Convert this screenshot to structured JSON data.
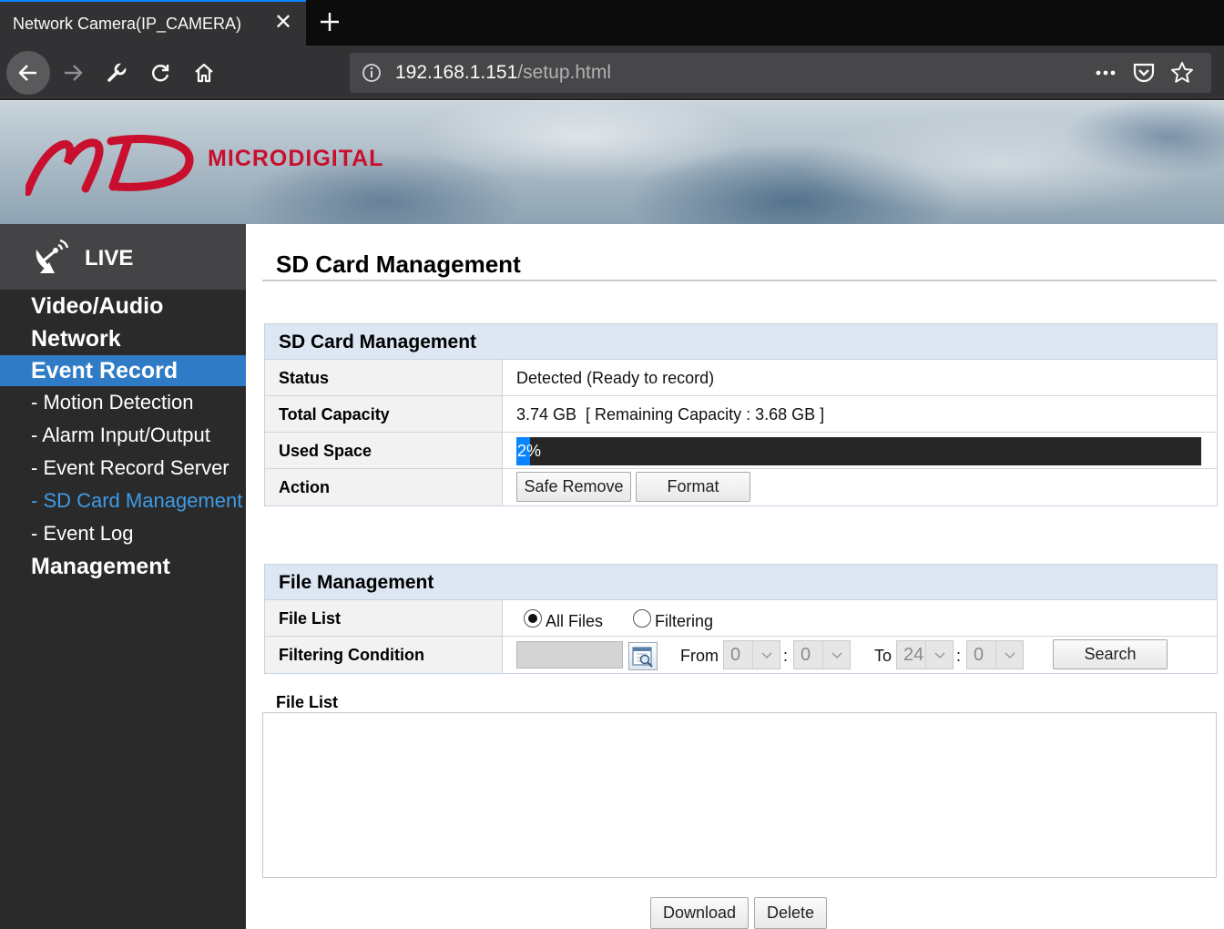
{
  "browser": {
    "tab_title": "Network Camera(IP_CAMERA)",
    "url_host": "192.168.1.151",
    "url_path": "/setup.html"
  },
  "header": {
    "brand": "MICRODIGITAL",
    "logo_color": "#c8102e"
  },
  "sidebar": {
    "live_label": "LIVE",
    "active_color": "#2f7bc6",
    "current_color": "#3f9be6",
    "items": [
      {
        "label": "Video/Audio"
      },
      {
        "label": "Network"
      },
      {
        "label": "Event Record"
      },
      {
        "label": "- Motion Detection"
      },
      {
        "label": "- Alarm Input/Output"
      },
      {
        "label": "- Event Record Server"
      },
      {
        "label": "- SD Card Management"
      },
      {
        "label": "- Event Log"
      },
      {
        "label": "Management"
      }
    ]
  },
  "page": {
    "title": "SD Card Management"
  },
  "sd_panel": {
    "title": "SD Card Management",
    "status_label": "Status",
    "status_value": "Detected (Ready to record)",
    "capacity_label": "Total Capacity",
    "capacity_value": "3.74 GB  [ Remaining Capacity : 3.68 GB ]",
    "used_label": "Used Space",
    "used_text": "2%",
    "used_fraction": 0.02,
    "action_label": "Action",
    "safe_remove": "Safe Remove",
    "format": "Format"
  },
  "file_panel": {
    "title": "File Management",
    "file_list_label": "File List",
    "all_files": "All Files",
    "filtering": "Filtering",
    "filter_label": "Filtering Condition",
    "from": "From",
    "to": "To",
    "colon": ":",
    "from_hour": "0",
    "from_min": "0",
    "to_hour": "24",
    "to_min": "0",
    "search": "Search"
  },
  "files": {
    "label": "File List",
    "download": "Download",
    "delete": "Delete"
  }
}
